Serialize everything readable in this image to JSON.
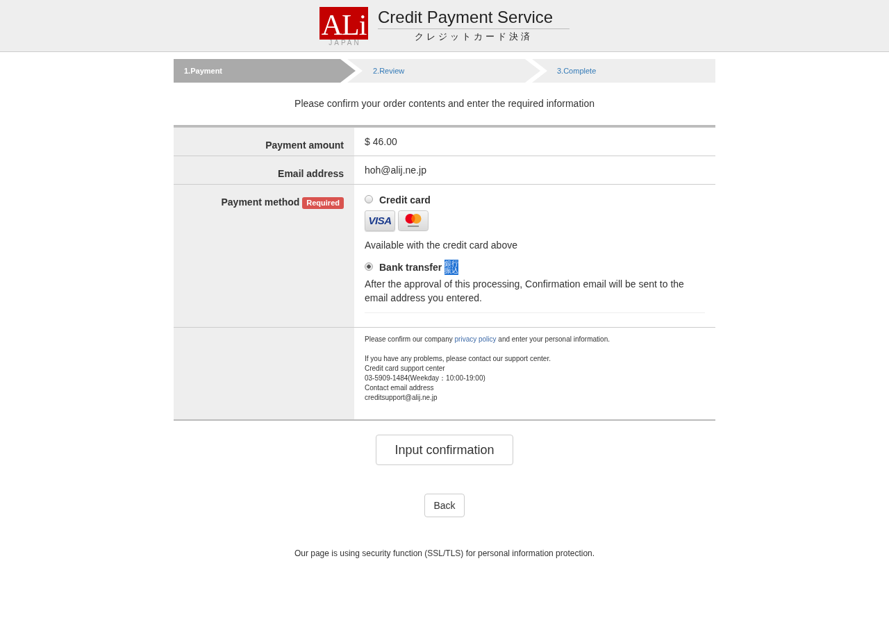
{
  "header": {
    "logo": {
      "mark": "ALi",
      "caption": "JAPAN"
    },
    "title": "Credit Payment Service",
    "subtitle": "クレジットカード決済"
  },
  "steps": [
    {
      "label": "1.Payment",
      "selected": true
    },
    {
      "label": "2.Review",
      "selected": false
    },
    {
      "label": "3.Complete",
      "selected": false
    }
  ],
  "intro": "Please confirm your order contents and enter the required information",
  "form": {
    "rows": [
      {
        "kind": "text",
        "label": "Payment amount",
        "value": "$ 46.00"
      },
      {
        "kind": "text",
        "label": "Email address",
        "value": "hoh@alij.ne.jp"
      },
      {
        "kind": "options",
        "label": "Payment method",
        "badge": "Required",
        "options": [
          {
            "label": "Credit card",
            "selected": false,
            "logos": [
              {
                "kind": "visa",
                "text": "VISA"
              },
              {
                "kind": "mastercard"
              }
            ],
            "note": "Available with the credit card above"
          },
          {
            "label": "Bank transfer",
            "selected": true,
            "tag": "銀行振込",
            "note": "After the approval of this processing, Confirmation email will be sent to the email address you entered."
          }
        ]
      },
      {
        "kind": "notice",
        "text": "Please confirm our company",
        "link": "privacy policy",
        "text_after": "and enter your personal information.",
        "lines": [
          "If you have any problems, please contact our support center.",
          "Credit card support center",
          "03-5909-1484(Weekday：10:00-19:00)",
          "Contact email address",
          "creditsupport@alij.ne.jp"
        ]
      }
    ]
  },
  "buttons": {
    "confirm": "Input confirmation",
    "back": "Back"
  },
  "footer": "Our page is using security function (SSL/TLS) for personal information protection."
}
